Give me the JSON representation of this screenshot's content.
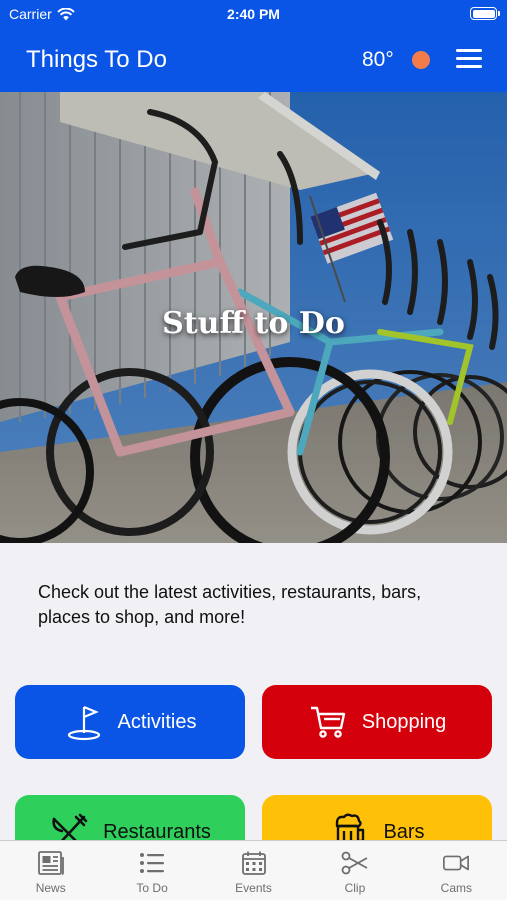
{
  "status_bar": {
    "carrier": "Carrier",
    "time": "2:40 PM"
  },
  "nav": {
    "title": "Things To Do",
    "temperature": "80°"
  },
  "hero": {
    "title": "Stuff to Do"
  },
  "intro": {
    "text": "Check out the latest activities, restaurants, bars, places to shop, and more!"
  },
  "tiles": [
    {
      "label": "Activities",
      "icon": "flag-hole-icon",
      "color": "#0a55e6"
    },
    {
      "label": "Shopping",
      "icon": "shopping-cart-icon",
      "color": "#d4000c"
    },
    {
      "label": "Restaurants",
      "icon": "fork-knife-icon",
      "color": "#2ecf5a"
    },
    {
      "label": "Bars",
      "icon": "beer-mug-icon",
      "color": "#ffc107"
    }
  ],
  "tabs": [
    {
      "label": "News",
      "icon": "newspaper-icon"
    },
    {
      "label": "To Do",
      "icon": "list-icon"
    },
    {
      "label": "Events",
      "icon": "calendar-icon"
    },
    {
      "label": "Clip",
      "icon": "scissors-icon"
    },
    {
      "label": "Cams",
      "icon": "video-camera-icon"
    }
  ]
}
